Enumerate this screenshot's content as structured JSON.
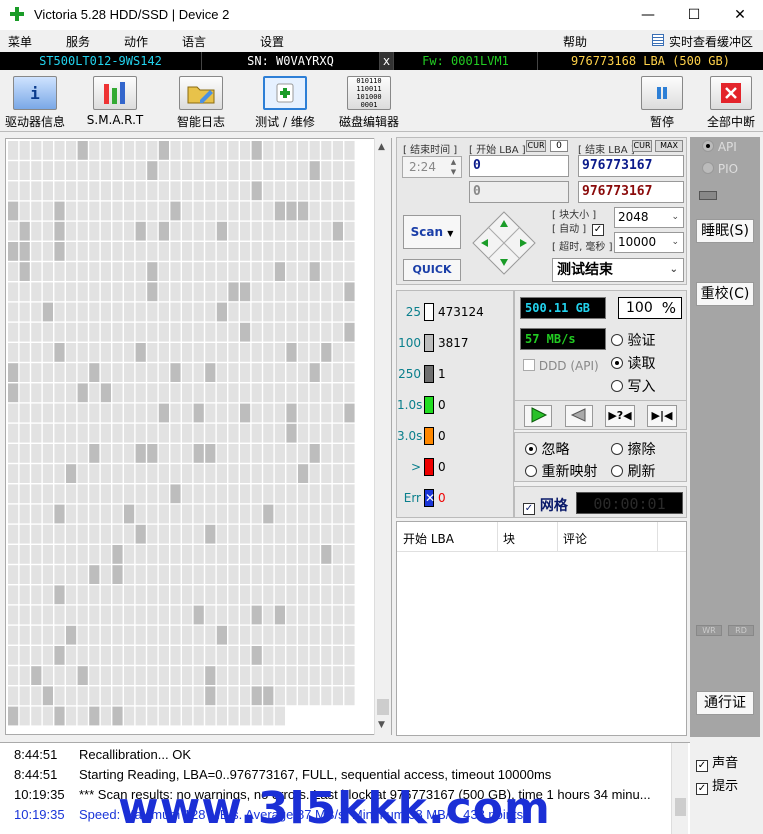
{
  "window": {
    "title": "Victoria 5.28 HDD/SSD | Device 2",
    "minimize_glyph": "—",
    "maximize_glyph": "☐",
    "close_glyph": "✕"
  },
  "menu": [
    "菜单",
    "服务",
    "动作",
    "语言",
    "设置",
    "帮助"
  ],
  "buffer_link": "实时查看缓冲区",
  "infobar": {
    "model": "ST500LT012-9WS142",
    "serial": "SN: W0VAYRXQ",
    "close": "x",
    "firmware": "Fw: 0001LVM1",
    "lba": "976773168 LBA (500 GB)",
    "colors": {
      "model": "#22d3ee",
      "serial": "#ffffff",
      "firmware": "#22cc22",
      "lba": "#ffd24a"
    }
  },
  "toolbar": {
    "drive_info": "驱动器信息",
    "smart": "S.M.A.R.T",
    "smart_log": "智能日志",
    "test_repair": "测试 / 维修",
    "disk_editor": "磁盘编辑器",
    "disk_editor_icon_text": "010110\n110011\n101000\n0001",
    "pause": "暂停",
    "stop_all": "全部中断"
  },
  "scan": {
    "end_time_label": "[ 结束时间 ]",
    "end_time_value": "2:24",
    "start_lba_label": "[ 开始 LBA ]",
    "cur_label": "CUR",
    "start_cur_value": "0",
    "end_lba_label": "[ 结束 LBA ]",
    "max_label": "MAX",
    "start_lba": "0",
    "end_lba": "976773167",
    "current_lba": "0",
    "current_end_lba": "976773167",
    "scan_button": "Scan",
    "quick_button": "QUICK",
    "block_size_label": "[ 块大小 ]",
    "auto_label": "[ 自动 ]",
    "timeout_label": "[ 超时, 毫秒 ]",
    "block_size": "2048",
    "timeout": "10000",
    "status": "测试结束"
  },
  "counters": [
    {
      "label": "25",
      "value": "473124",
      "color": "#ffffff"
    },
    {
      "label": "100",
      "value": "3817",
      "color": "#bdbdbd"
    },
    {
      "label": "250",
      "value": "1",
      "color": "#6e6e6e"
    },
    {
      "label": "1.0s",
      "value": "0",
      "color": "#22dd22"
    },
    {
      "label": "3.0s",
      "value": "0",
      "color": "#ff8800"
    },
    {
      "label": ">",
      "value": "0",
      "color": "#ee0000"
    },
    {
      "label": "Err",
      "value": "0",
      "color": "#1a35d8"
    }
  ],
  "stats": {
    "size": "500.11 GB",
    "percent": "100",
    "percent_sign": "%",
    "speed": "57 MB/s",
    "ddd": "DDD (API)",
    "verify": "验证",
    "read": "读取",
    "write": "写入",
    "ignore": "忽略",
    "erase": "擦除",
    "remap": "重新映射",
    "refresh": "刷新",
    "grid": "网格",
    "timer": "00:00:01"
  },
  "table": {
    "col_start": "开始 LBA",
    "col_block": "块",
    "col_comment": "评论"
  },
  "side": {
    "api": "API",
    "pio": "PIO",
    "sleep": "睡眠(S)",
    "recal": "重校(C)",
    "wr": "WR",
    "rd": "RD",
    "passport": "通行证"
  },
  "log": [
    {
      "time": "8:44:51",
      "msg": "Recallibration... OK",
      "color": "#000000"
    },
    {
      "time": "8:44:51",
      "msg": "Starting Reading, LBA=0..976773167, FULL, sequential access, timeout 10000ms",
      "color": "#000000"
    },
    {
      "time": "10:19:35",
      "msg": "*** Scan results: no warnings, no errors. Last block at 976773167 (500 GB), time 1 hours 34 minu...",
      "color": "#000000"
    },
    {
      "time": "10:19:35",
      "msg": "Speed: Maximum 128 MB/s. Average 87 MB/s. Minimum 38 MB/s. 438 points.",
      "color": "#1a35d8"
    }
  ],
  "sound": "声音",
  "hints": "提示",
  "watermark": "www.3l5kkk.com"
}
